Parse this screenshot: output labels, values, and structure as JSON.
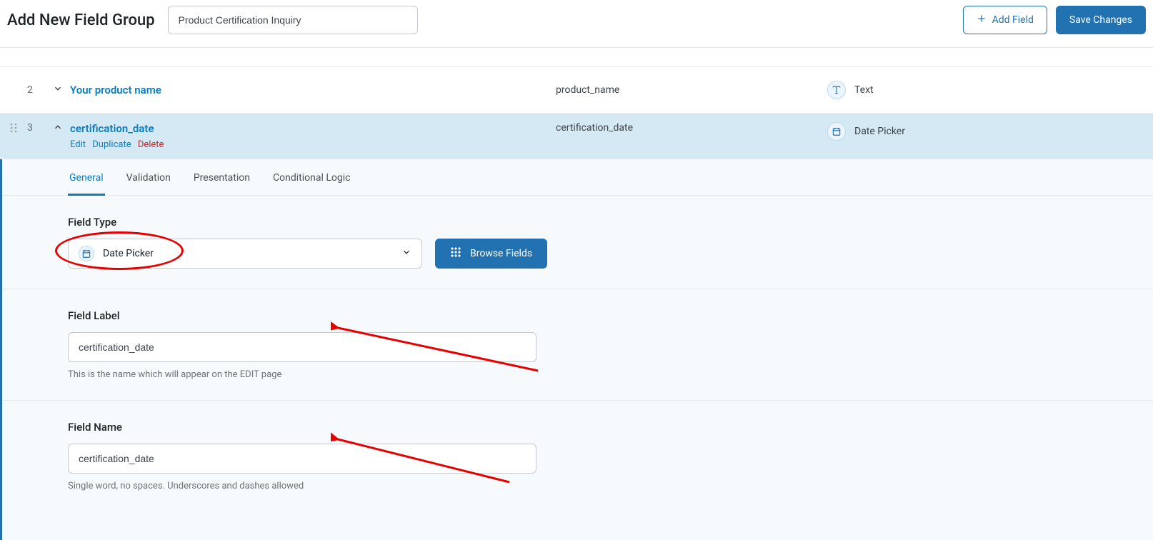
{
  "header": {
    "title": "Add New Field Group",
    "group_name_value": "Product Certification Inquiry",
    "add_field_label": "Add Field",
    "save_label": "Save Changes"
  },
  "rows": [
    {
      "num": "2",
      "label": "Your product name",
      "name": "product_name",
      "type_label": "Text",
      "type_icon": "text-icon"
    },
    {
      "num": "3",
      "label": "certification_date",
      "name": "certification_date",
      "type_label": "Date Picker",
      "type_icon": "calendar-icon"
    }
  ],
  "row_actions": {
    "edit": "Edit",
    "duplicate": "Duplicate",
    "delete": "Delete"
  },
  "tabs": {
    "general": "General",
    "validation": "Validation",
    "presentation": "Presentation",
    "conditional": "Conditional Logic"
  },
  "editor": {
    "field_type_label": "Field Type",
    "field_type_value": "Date Picker",
    "browse_label": "Browse Fields",
    "field_label_label": "Field Label",
    "field_label_value": "certification_date",
    "field_label_hint": "This is the name which will appear on the EDIT page",
    "field_name_label": "Field Name",
    "field_name_value": "certification_date",
    "field_name_hint": "Single word, no spaces. Underscores and dashes allowed"
  }
}
